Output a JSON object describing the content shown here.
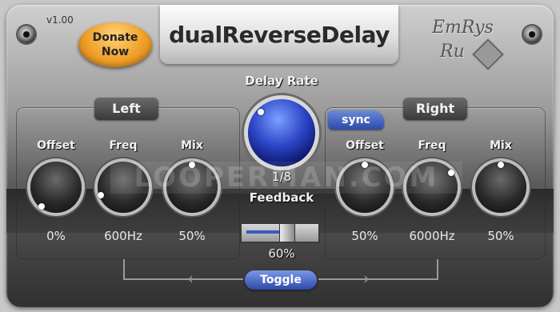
{
  "header": {
    "version": "v1.00",
    "donate_line1": "Donate",
    "donate_line2": "Now",
    "title": "dualReverseDelay",
    "brand_line1": "EmRys",
    "brand_line2": "Ru"
  },
  "center": {
    "delay_rate_label": "Delay Rate",
    "delay_rate_value": "1/8",
    "sync_label": "sync",
    "feedback_label": "Feedback",
    "feedback_value": "60%",
    "feedback_level": 0.6,
    "toggle_label": "Toggle"
  },
  "left": {
    "title": "Left",
    "knobs": [
      {
        "label": "Offset",
        "value": "0%"
      },
      {
        "label": "Freq",
        "value": "600Hz"
      },
      {
        "label": "Mix",
        "value": "50%"
      }
    ]
  },
  "right": {
    "title": "Right",
    "knobs": [
      {
        "label": "Offset",
        "value": "50%"
      },
      {
        "label": "Freq",
        "value": "6000Hz"
      },
      {
        "label": "Mix",
        "value": "50%"
      }
    ]
  },
  "watermark": "LOOPERMAN.COM",
  "colors": {
    "accent_blue": "#2d4aa8",
    "donate_orange": "#f0a02a"
  }
}
